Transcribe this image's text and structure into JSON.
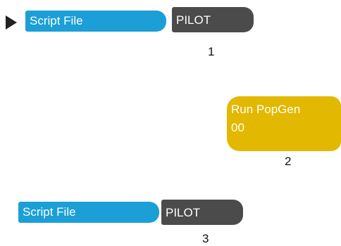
{
  "flow": {
    "row1": {
      "script_label": "Script File",
      "pilot_label": "PILOT",
      "step": "1"
    },
    "row2": {
      "popgen_line1": "Run PopGen",
      "popgen_line2": "00",
      "step": "2"
    },
    "row3": {
      "script_label": "Script File",
      "pilot_label": "PILOT",
      "step": "3"
    }
  },
  "icons": {
    "run": "play-icon"
  },
  "colors": {
    "script": "#1b9fd6",
    "pilot": "#4b4b4b",
    "popgen": "#e3b800"
  }
}
